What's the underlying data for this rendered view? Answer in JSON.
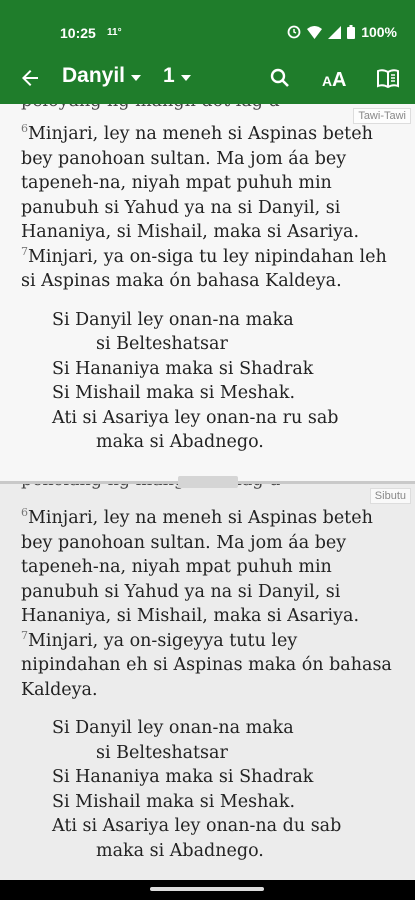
{
  "status": {
    "time": "10:25",
    "temp": "11°",
    "battery": "100%"
  },
  "toolbar": {
    "book": "Danyil",
    "chapter": "1"
  },
  "panes": [
    {
      "label": "Tawi-Tawi",
      "v6": "6",
      "v6_text": "Minjari, ley na meneh si Aspinas beteh bey panohoan sultan. Ma jom áa bey tapeneh-na, niyah mpat puhuh min panubuh si Yahud ya na si Danyil, si Hananiya, si Mishail, maka si Asariya.",
      "v7": "7",
      "v7_text": "Minjari, ya on-siga tu ley nipindahan leh si Aspinas maka ón bahasa Kaldeya.",
      "poem": [
        "Si Danyil ley onan-na maka",
        "si Belteshatsar",
        "Si Hananiya maka si Shadrak",
        "Si Mishail maka si Meshak.",
        "Ati si Asariya ley onan-na ru sab",
        "maka si Abadnego."
      ]
    },
    {
      "label": "Sibutu",
      "v6": "6",
      "v6_text": "Minjari, ley na meneh si Aspinas beteh bey panohoan sultan. Ma jom áa bey tapeneh-na, niyah mpat puhuh min panubuh si Yahud ya na si Danyil, si Hananiya, si Mishail, maka si Asariya.",
      "v7": "7",
      "v7_text": "Minjari, ya on-sigeyya tutu ley nipindahan eh si Aspinas maka ón bahasa Kaldeya.",
      "poem": [
        "Si Danyil ley onan-na maka",
        "si Belteshatsar",
        "Si Hananiya maka si Shadrak",
        "Si Mishail maka si Meshak.",
        "Ati si Asariya ley onan-na du sab",
        "maka si Abadnego."
      ]
    }
  ]
}
